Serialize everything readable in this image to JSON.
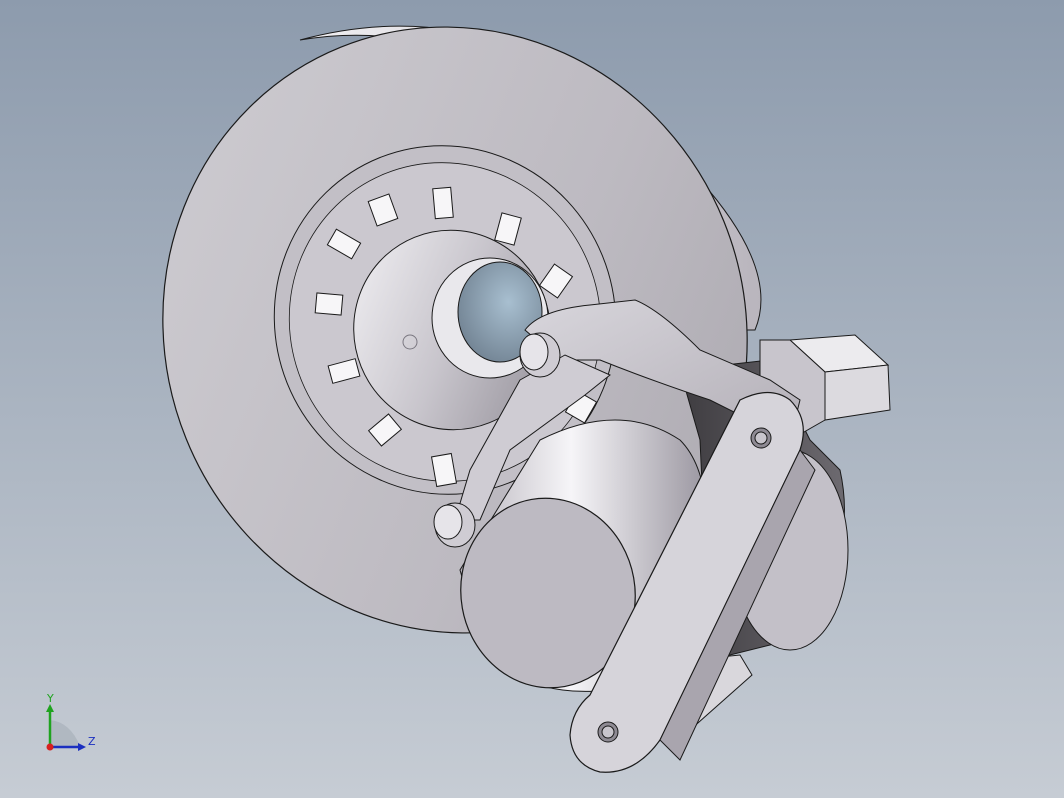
{
  "viewport": {
    "background_top": "#8d9bad",
    "background_bottom": "#c6ccd4"
  },
  "model": {
    "part_color": "#c9c6cd",
    "edge_color": "#1a1a1a"
  },
  "triad": {
    "y_label": "Y",
    "z_label": "Z",
    "y_color": "#1fa31f",
    "z_color": "#1b2fc0",
    "origin_color": "#d81f1f"
  }
}
